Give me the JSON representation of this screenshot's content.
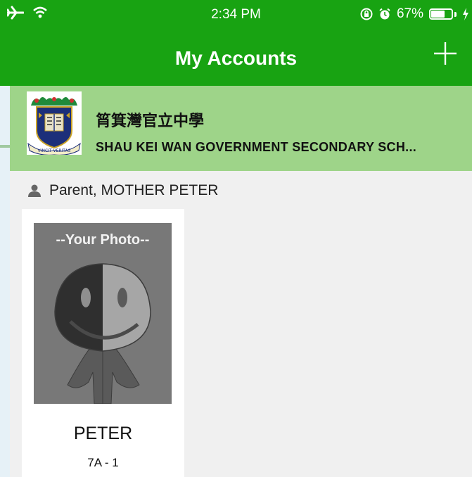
{
  "status_bar": {
    "time": "2:34 PM",
    "battery": "67%",
    "battery_level": 0.67
  },
  "nav": {
    "title": "My Accounts",
    "add_icon": "plus-icon"
  },
  "school": {
    "name_zh": "筲箕灣官立中學",
    "name_en": "SHAU KEI WAN GOVERNMENT SECONDARY SCH...",
    "logo_motto": "VINCIT VERITAS"
  },
  "parent": {
    "icon": "person-icon",
    "label": "Parent, MOTHER PETER"
  },
  "students": [
    {
      "photo_text": "--Your Photo--",
      "name": "PETER",
      "class": "7A - 1"
    }
  ],
  "colors": {
    "header": "#18a312",
    "school_banner": "#9ed489",
    "background": "#f0f0f0"
  }
}
